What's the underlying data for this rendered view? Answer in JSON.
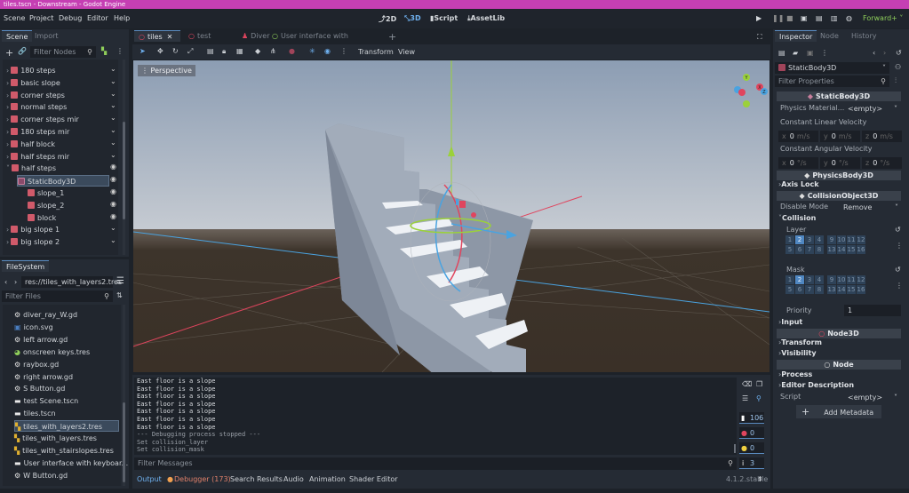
{
  "window": {
    "title": "tiles.tscn - Downstream - Godot Engine"
  },
  "menu": [
    "Scene",
    "Project",
    "Debug",
    "Editor",
    "Help"
  ],
  "workspaces": {
    "2d": "2D",
    "3d": "3D",
    "script": "Script",
    "assetlib": "AssetLib",
    "renderer": "Forward+"
  },
  "scene_dock": {
    "tabs": [
      "Scene",
      "Import"
    ],
    "filter_placeholder": "Filter Nodes",
    "tree": [
      {
        "label": "180 steps",
        "depth": 1,
        "vis": "collapsed"
      },
      {
        "label": "basic slope",
        "depth": 1,
        "vis": "collapsed"
      },
      {
        "label": "corner steps",
        "depth": 1,
        "vis": "collapsed"
      },
      {
        "label": "normal steps",
        "depth": 1,
        "vis": "collapsed"
      },
      {
        "label": "corner steps mir",
        "depth": 1,
        "vis": "collapsed"
      },
      {
        "label": "180 steps mir",
        "depth": 1,
        "vis": "collapsed"
      },
      {
        "label": "half block",
        "depth": 1,
        "vis": "collapsed"
      },
      {
        "label": "half steps mir",
        "depth": 1,
        "vis": "collapsed"
      },
      {
        "label": "half steps",
        "depth": 1,
        "vis": "eye"
      },
      {
        "label": "StaticBody3D",
        "depth": 2,
        "vis": "eye",
        "selected": true
      },
      {
        "label": "slope_1",
        "depth": 3,
        "vis": "eye"
      },
      {
        "label": "slope_2",
        "depth": 3,
        "vis": "eye"
      },
      {
        "label": "block",
        "depth": 3,
        "vis": "eye"
      },
      {
        "label": "big slope 1",
        "depth": 1,
        "vis": "collapsed"
      },
      {
        "label": "big slope 2",
        "depth": 1,
        "vis": "collapsed"
      }
    ]
  },
  "filesystem": {
    "tab": "FileSystem",
    "path": "res://tiles_with_layers2.tres",
    "filter_placeholder": "Filter Files",
    "files": [
      {
        "label": "diver_ray_W.gd",
        "icon": "gear"
      },
      {
        "label": "icon.svg",
        "icon": "image"
      },
      {
        "label": "left arrow.gd",
        "icon": "gear"
      },
      {
        "label": "onscreen keys.tres",
        "icon": "theme"
      },
      {
        "label": "raybox.gd",
        "icon": "gear"
      },
      {
        "label": "right arrow.gd",
        "icon": "gear"
      },
      {
        "label": "S Button.gd",
        "icon": "gear"
      },
      {
        "label": "test Scene.tscn",
        "icon": "scene"
      },
      {
        "label": "tiles.tscn",
        "icon": "scene"
      },
      {
        "label": "tiles_with_layers2.tres",
        "icon": "tileset",
        "selected": true
      },
      {
        "label": "tiles_with_layers.tres",
        "icon": "tileset"
      },
      {
        "label": "tiles_with_stairslopes.tres",
        "icon": "tileset"
      },
      {
        "label": "User interface with keyboar...",
        "icon": "scene"
      },
      {
        "label": "W Button.gd",
        "icon": "gear"
      }
    ]
  },
  "editor_tabs": [
    {
      "label": "tiles",
      "closable": true,
      "active": true
    },
    {
      "label": "test Scene(*)"
    },
    {
      "label": "Diver"
    },
    {
      "label": "User interface with keyboard"
    }
  ],
  "viewport": {
    "menus": [
      "Transform",
      "View"
    ],
    "view_label": "Perspective",
    "gizmo_axes": [
      "X",
      "Y",
      "Z"
    ]
  },
  "output": {
    "lines": [
      "East floor is a slope",
      "East floor is a slope",
      "East floor is a slope",
      "East floor is a slope",
      "East floor is a slope",
      "East floor is a slope",
      "East floor is a slope",
      "--- Debugging process stopped ---",
      "Set collision_layer",
      "Set collision_mask"
    ],
    "filter_placeholder": "Filter Messages",
    "counts": {
      "messages": "106",
      "errors": "0",
      "warnings": "0",
      "info": "3"
    }
  },
  "bottom_tabs": [
    "Output",
    "Debugger (173)",
    "Search Results",
    "Audio",
    "Animation",
    "Shader Editor"
  ],
  "version": "4.1.2.stable",
  "inspector": {
    "tabs": [
      "Inspector",
      "Node",
      "History"
    ],
    "node": "StaticBody3D",
    "filter_placeholder": "Filter Properties",
    "h_static": "StaticBody3D",
    "physics_material": "Physics Material...",
    "empty": "<empty>",
    "lin_vel": "Constant Linear Velocity",
    "ang_vel": "Constant Angular Velocity",
    "lin": [
      {
        "axis": "x",
        "val": "0",
        "unit": "m/s"
      },
      {
        "axis": "y",
        "val": "0",
        "unit": "m/s"
      },
      {
        "axis": "z",
        "val": "0",
        "unit": "m/s"
      }
    ],
    "ang": [
      {
        "axis": "x",
        "val": "0",
        "unit": "°/s"
      },
      {
        "axis": "y",
        "val": "0",
        "unit": "°/s"
      },
      {
        "axis": "z",
        "val": "0",
        "unit": "°/s"
      }
    ],
    "h_physics": "PhysicsBody3D",
    "axis_lock": "Axis Lock",
    "h_collision": "CollisionObject3D",
    "disable_mode": "Disable Mode",
    "disable_value": "Remove",
    "collision": "Collision",
    "layer": "Layer",
    "mask": "Mask",
    "layer_active": [
      2
    ],
    "mask_active": [
      2
    ],
    "priority": "Priority",
    "priority_value": "1",
    "input": "Input",
    "h_node3d": "Node3D",
    "transform": "Transform",
    "visibility": "Visibility",
    "h_node": "Node",
    "process": "Process",
    "editor_description": "Editor Description",
    "script": "Script",
    "script_value": "<empty>",
    "add_metadata": "Add Metadata"
  }
}
